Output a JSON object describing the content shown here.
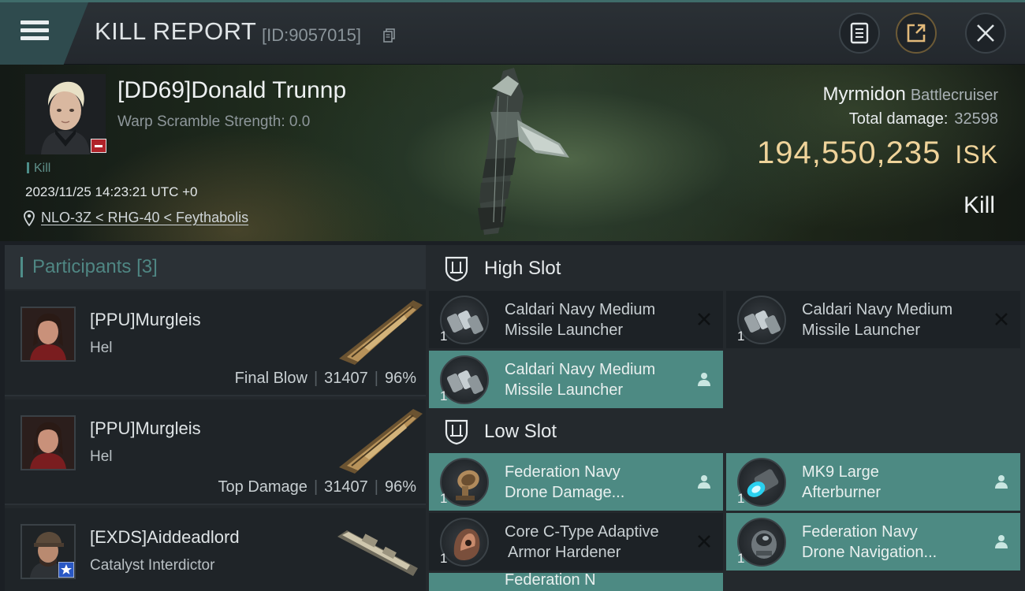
{
  "header": {
    "title": "KILL REPORT",
    "report_id": "[ID:9057015]"
  },
  "victim": {
    "name": "[DD69]Donald Trunnp",
    "warp_scramble": "Warp Scramble Strength: 0.0",
    "kill_tag": "Kill",
    "timestamp": "2023/11/25 14:23:21 UTC +0",
    "location": "NLO-3Z < RHG-40 < Feythabolis"
  },
  "ship": {
    "name": "Myrmidon",
    "class": "Battlecruiser",
    "total_damage_label": "Total damage:",
    "total_damage": "32598",
    "isk_value": "194,550,235",
    "isk_unit": "ISK",
    "result": "Kill"
  },
  "participants": {
    "label": "Participants",
    "count": "[3]",
    "items": [
      {
        "name": "[PPU]Murgleis",
        "ship": "Hel",
        "role": "Final Blow",
        "damage": "31407",
        "percent": "96%"
      },
      {
        "name": "[PPU]Murgleis",
        "ship": "Hel",
        "role": "Top Damage",
        "damage": "31407",
        "percent": "96%"
      },
      {
        "name": "[EXDS]Aiddeadlord",
        "ship": "Catalyst Interdictor",
        "role": "",
        "damage": "",
        "percent": ""
      }
    ]
  },
  "fitting": {
    "high_slot_label": "High Slot",
    "low_slot_label": "Low Slot",
    "high_slot": [
      {
        "line1": "Caldari Navy Medium",
        "line2": "Missile Launcher",
        "qty": "1",
        "state": "destroyed"
      },
      {
        "line1": "Caldari Navy Medium",
        "line2": "Missile Launcher",
        "qty": "1",
        "state": "destroyed"
      },
      {
        "line1": "Caldari Navy Medium",
        "line2": "Missile Launcher",
        "qty": "1",
        "state": "dropped"
      }
    ],
    "low_slot": [
      {
        "line1": "Federation Navy",
        "line2": "Drone Damage...",
        "qty": "1",
        "state": "dropped"
      },
      {
        "line1": "MK9 Large",
        "line2": "Afterburner",
        "qty": "1",
        "state": "dropped"
      },
      {
        "line1": "Core C-Type Adaptive",
        "line2": "Armor Hardener",
        "qty": "1",
        "state": "destroyed"
      },
      {
        "line1": "Federation Navy",
        "line2": "Drone Navigation...",
        "qty": "1",
        "state": "dropped"
      },
      {
        "line1": "Federation N",
        "line2": "",
        "qty": "",
        "state": "dropped"
      }
    ]
  },
  "colors": {
    "accent_teal": "#4d8a83",
    "isk_gold": "#efd39a",
    "header_bg": "#2b3136",
    "victim_badge_red": "#b0232a"
  },
  "icons": {
    "menu": "hamburger-menu-icon",
    "copy": "copy-icon",
    "report": "document-icon",
    "share": "share-icon",
    "close": "close-icon",
    "location": "map-pin-icon",
    "slot": "slot-shield-icon",
    "destroyed": "x-icon",
    "dropped": "person-icon"
  }
}
